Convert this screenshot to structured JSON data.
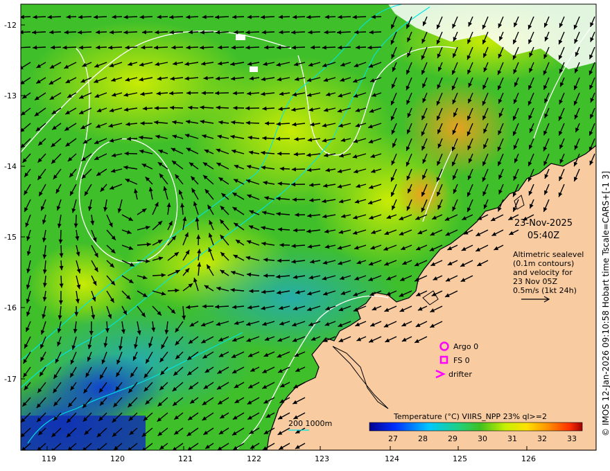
{
  "map": {
    "lat_ticks": [
      "-12",
      "-13",
      "-14",
      "-15",
      "-16",
      "-17"
    ],
    "lon_ticks": [
      "119",
      "120",
      "121",
      "122",
      "123",
      "124",
      "125",
      "126"
    ],
    "date": "23-Nov-2025",
    "time": "05:40Z",
    "legend_lines": [
      "Altimetric sealevel",
      "(0.1m contours)",
      "and velocity for",
      "23 Nov 05Z",
      "0.5m/s (1kt 24h)"
    ],
    "symbols": {
      "argo": "Argo 0",
      "fs": "FS 0",
      "drifter": "drifter"
    },
    "depth_label": "200  1000m",
    "colorbar_title": "Temperature (°C) VIIRS_NPP 23% ql>=2",
    "colorbar_ticks": [
      "27",
      "28",
      "29",
      "30",
      "31",
      "32",
      "33"
    ],
    "copyright": "© IMOS 12-Jan-2026 09:10:58 Hobart time Tscale=CARS+[-1 3]",
    "colors": {
      "land": "#f8cba0",
      "argo": "#ff00ff",
      "contour": "#ffffff",
      "isobath": "#00e5e5"
    }
  }
}
